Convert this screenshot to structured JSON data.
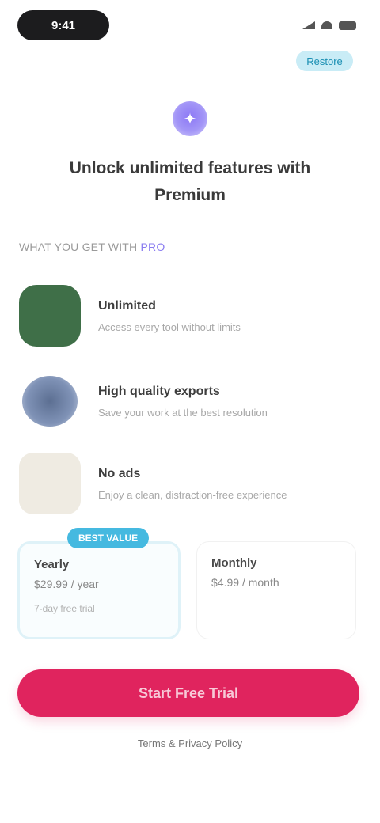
{
  "status_bar": {
    "time": "9:41"
  },
  "header": {
    "restore_label": "Restore"
  },
  "hero": {
    "title": "Unlock unlimited features with Premium"
  },
  "section": {
    "label_prefix": "WHAT YOU GET WITH",
    "label_accent": "PRO"
  },
  "features": [
    {
      "title": "Unlimited",
      "description": "Access every tool without limits",
      "thumb": "green"
    },
    {
      "title": "High quality exports",
      "description": "Save your work at the best resolution",
      "thumb": "blue"
    },
    {
      "title": "No ads",
      "description": "Enjoy a clean, distraction-free experience",
      "thumb": "beige"
    }
  ],
  "plans": [
    {
      "badge": "BEST VALUE",
      "name": "Yearly",
      "price": "$29.99 / year",
      "note": "7-day free trial",
      "selected": true
    },
    {
      "name": "Monthly",
      "price": "$4.99 / month",
      "note": "",
      "selected": false
    }
  ],
  "cta": {
    "label": "Start Free Trial"
  },
  "legal": {
    "text": "Terms & Privacy Policy"
  },
  "colors": {
    "accent": "#e0245e",
    "badge": "#45b9e0",
    "hero_icon": "#8c78f5"
  }
}
